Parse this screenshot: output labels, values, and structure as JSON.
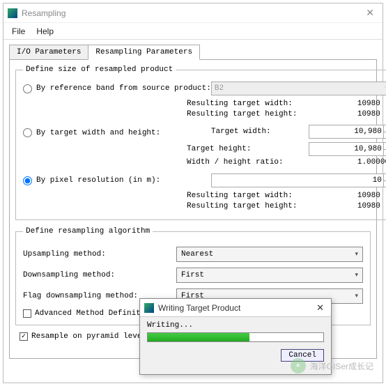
{
  "window": {
    "title": "Resampling",
    "menu": {
      "file": "File",
      "help": "Help"
    }
  },
  "tabs": {
    "io": "I/O Parameters",
    "resamp": "Resampling Parameters"
  },
  "size_group": {
    "legend": "Define size of resampled product",
    "by_ref": "By reference band from source product:",
    "ref_band": "B2",
    "res_w_lbl": "Resulting target width:",
    "res_h_lbl": "Resulting target height:",
    "res_w": "10980",
    "res_h": "10980",
    "by_wh": "By target width and height:",
    "tw_lbl": "Target width:",
    "th_lbl": "Target height:",
    "tw": "10,980",
    "th": "10,980",
    "ratio_lbl": "Width / height ratio:",
    "ratio": "1.00000",
    "by_px": "By pixel resolution (in m):",
    "px_val": "10",
    "res2_w": "10980",
    "res2_h": "10980"
  },
  "algo_group": {
    "legend": "Define resampling algorithm",
    "up_lbl": "Upsampling method:",
    "up_val": "Nearest",
    "down_lbl": "Downsampling method:",
    "down_val": "First",
    "flag_lbl": "Flag downsampling method:",
    "flag_val": "First",
    "adv": "Advanced Method Definit"
  },
  "resample_pyr": "Resample on pyramid leve",
  "dialog": {
    "title": "Writing Target Product",
    "msg": "Writing...",
    "cancel": "Cancel"
  },
  "watermark": "海洋GISer成长记"
}
